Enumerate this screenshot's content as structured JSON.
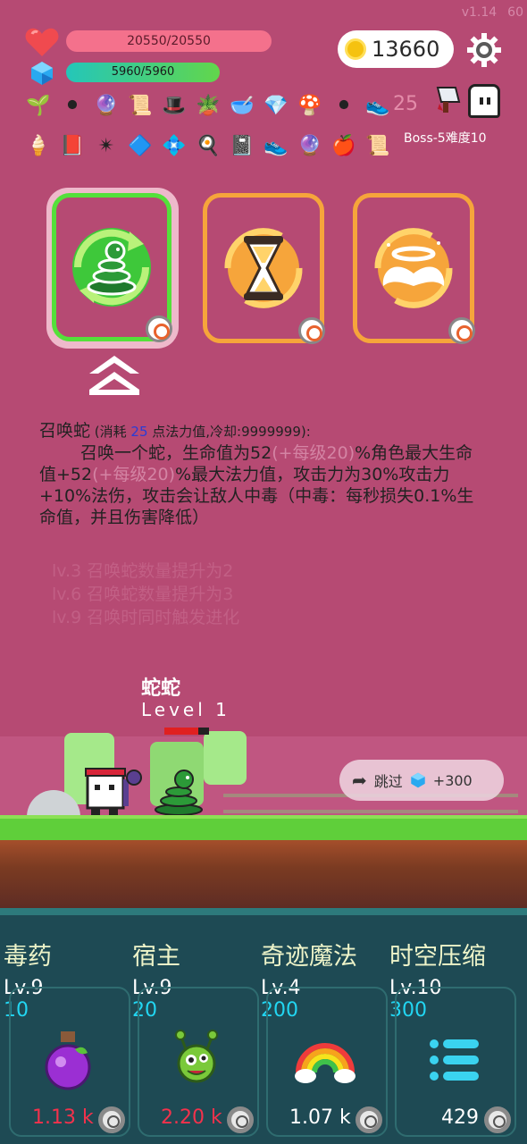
{
  "header": {
    "version": "v1.14",
    "fps": "60"
  },
  "stats": {
    "hp_text": "20550/20550",
    "hp_fraction": 1.0,
    "mp_text": "5960/5960",
    "mp_fraction": 1.0,
    "coins": "13660"
  },
  "inventory": {
    "row1": [
      "sapling-icon",
      "cauldron-icon",
      "crystal-ball-icon",
      "scroll-icon",
      "wizard-hat-icon",
      "potted-plant-icon",
      "mortar-icon",
      "diamond-icon",
      "mushroom-icon",
      "cauldron-icon",
      "sneaker-icon"
    ],
    "row2": [
      "ice-cream-icon",
      "spellbook-icon",
      "shuriken-icon",
      "blue-gem-icon",
      "diamond-icon",
      "fried-egg-icon",
      "skull-book-icon",
      "sneaker-icon",
      "crystal-ball-icon",
      "apple-icon",
      "scroll-icon"
    ],
    "faded_count": "25",
    "boss_label": "Boss-5难度10"
  },
  "cards": [
    {
      "name": "snake-summon",
      "selected": true
    },
    {
      "name": "hourglass",
      "selected": false
    },
    {
      "name": "angel-halo",
      "selected": false
    }
  ],
  "description": {
    "title": "召唤蛇",
    "cost_prefix": " (消耗 ",
    "cost_mana": "25",
    "cost_suffix": " 点法力值,冷却:9999999):",
    "body_1": "召唤一个蛇，生命值为52",
    "body_dim_1": "(+每级20)",
    "body_2": "%角色最大生命值+52",
    "body_dim_2": "(+每级20)",
    "body_3": "%最大法力值，攻击力为30%攻击力+10%法伤，攻击会让敌人中毒（中毒：每秒损失0.1%生命值，并且伤害降低）",
    "levels": [
      "lv.3 召唤蛇数量提升为2",
      "lv.6 召唤蛇数量提升为3",
      "lv.9 召唤时同时触发进化"
    ]
  },
  "scene": {
    "pet_name": "蛇蛇",
    "pet_level": "Level 1",
    "pet_hp_fraction": 0.75,
    "skip_label": "跳过",
    "skip_reward": "+300"
  },
  "skills": [
    {
      "name": "毒药",
      "level": "Lv.9",
      "cost": "10",
      "value": "1.13 k",
      "value_color": "red",
      "icon": "poison-potion-icon"
    },
    {
      "name": "宿主",
      "level": "Lv.9",
      "cost": "20",
      "value": "2.20 k",
      "value_color": "red",
      "icon": "germ-monster-icon"
    },
    {
      "name": "奇迹魔法",
      "level": "Lv.4",
      "cost": "200",
      "value": "1.07 k",
      "value_color": "white",
      "icon": "rainbow-icon"
    },
    {
      "name": "时空压缩",
      "level": "Lv.10",
      "cost": "300",
      "value": "429",
      "value_color": "white",
      "icon": "list-icon"
    }
  ],
  "colors": {
    "background": "#b64a73",
    "panel": "#1e4a54",
    "hp": "#f4718c",
    "accent_cyan": "#22d6f2",
    "accent_red": "#f3324c"
  }
}
